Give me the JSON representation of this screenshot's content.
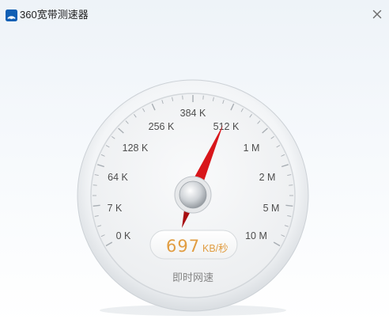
{
  "app": {
    "title": "360宽带测速器",
    "icon": "360-logo-icon"
  },
  "titlebar": {
    "close_icon": "close-icon"
  },
  "gauge": {
    "scale_labels": [
      "0 K",
      "7 K",
      "64 K",
      "128 K",
      "256 K",
      "384 K",
      "512 K",
      "1 M",
      "2 M",
      "5 M",
      "10 M"
    ],
    "needle_color": "#d8161b",
    "readout": {
      "value": "697",
      "unit": "KB/秒"
    },
    "mode_label": "即时网速"
  }
}
